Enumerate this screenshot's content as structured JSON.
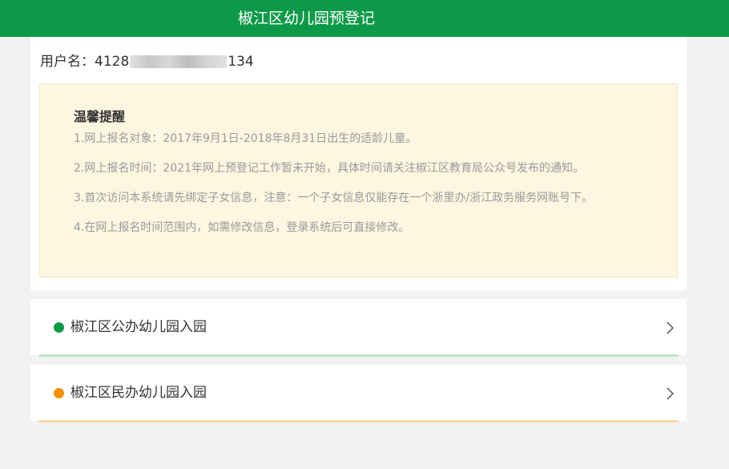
{
  "header": {
    "title": "椒江区幼儿园预登记"
  },
  "user": {
    "label": "用户名：",
    "id_prefix": "4128",
    "id_suffix": "134"
  },
  "notice": {
    "title": "温馨提醒",
    "items": [
      "1.网上报名对象：2017年9月1日-2018年8月31日出生的适龄儿童。",
      "2.网上报名时间：2021年网上预登记工作暂未开始，具体时间请关注椒江区教育局公众号发布的通知。",
      "3.首次访问本系统请先绑定子女信息，注意：一个子女信息仅能存在一个浙里办/浙江政务服务网账号下。",
      "4.在网上报名时间范围内，如需修改信息，登录系统后可直接修改。"
    ]
  },
  "entries": [
    {
      "label": "椒江区公办幼儿园入园",
      "color": "#0d9a48"
    },
    {
      "label": "椒江区民办幼儿园入园",
      "color": "#f39200"
    }
  ],
  "icons": {
    "dot": "status-dot",
    "arrow": "chevron-right-icon"
  }
}
